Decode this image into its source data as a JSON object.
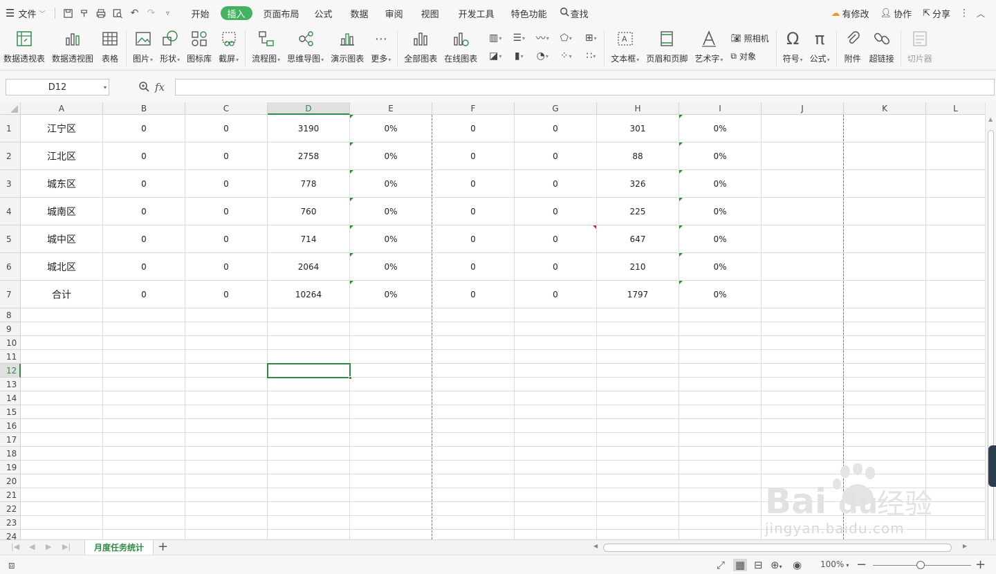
{
  "menu": {
    "file_label": "文件",
    "tabs": [
      "开始",
      "插入",
      "页面布局",
      "公式",
      "数据",
      "审阅",
      "视图",
      "开发工具",
      "特色功能"
    ],
    "active_tab": "插入",
    "search_label": "查找",
    "right": {
      "modified": "有修改",
      "collab": "协作",
      "share": "分享"
    }
  },
  "ribbon": {
    "pivot_table": "数据透视表",
    "pivot_chart": "数据透视图",
    "table": "表格",
    "picture": "图片",
    "shape": "形状",
    "icon_lib": "图标库",
    "screenshot": "截屏",
    "flowchart": "流程图",
    "mindmap": "思维导图",
    "demo_chart": "演示图表",
    "more": "更多",
    "all_charts": "全部图表",
    "online_charts": "在线图表",
    "textbox": "文本框",
    "header_footer": "页眉和页脚",
    "wordart": "艺术字",
    "camera": "照相机",
    "object": "对象",
    "symbol": "符号",
    "formula": "公式",
    "attachment": "附件",
    "hyperlink": "超链接",
    "slicer": "切片器"
  },
  "formula_bar": {
    "cell_ref": "D12",
    "fx_label": "fx",
    "value": ""
  },
  "columns": [
    "A",
    "B",
    "C",
    "D",
    "E",
    "F",
    "G",
    "H",
    "I",
    "J",
    "K",
    "L"
  ],
  "active_column": "D",
  "active_row": "12",
  "row_numbers": [
    "1",
    "2",
    "3",
    "4",
    "5",
    "6",
    "7",
    "8",
    "9",
    "10",
    "11",
    "12",
    "13",
    "14",
    "15",
    "16",
    "17",
    "18",
    "19",
    "20",
    "21",
    "22",
    "23",
    "24"
  ],
  "rows": [
    [
      "江宁区",
      "0",
      "0",
      "3190",
      "0%",
      "0",
      "0",
      "301",
      "0%"
    ],
    [
      "江北区",
      "0",
      "0",
      "2758",
      "0%",
      "0",
      "0",
      "88",
      "0%"
    ],
    [
      "城东区",
      "0",
      "0",
      "778",
      "0%",
      "0",
      "0",
      "326",
      "0%"
    ],
    [
      "城南区",
      "0",
      "0",
      "760",
      "0%",
      "0",
      "0",
      "225",
      "0%"
    ],
    [
      "城中区",
      "0",
      "0",
      "714",
      "0%",
      "0",
      "0",
      "647",
      "0%"
    ],
    [
      "城北区",
      "0",
      "0",
      "2064",
      "0%",
      "0",
      "0",
      "210",
      "0%"
    ],
    [
      "合计",
      "0",
      "0",
      "10264",
      "0%",
      "0",
      "0",
      "1797",
      "0%"
    ]
  ],
  "sheet_tab": "月度任务统计",
  "status": {
    "zoom": "100%"
  },
  "watermark": {
    "brand": "Bai du 经验",
    "url": "jingyan.baidu.com"
  },
  "colors": {
    "accent": "#44b35f",
    "selection": "#2e8b45",
    "marker_green": "#2a8a2a",
    "marker_red": "#e02020"
  }
}
